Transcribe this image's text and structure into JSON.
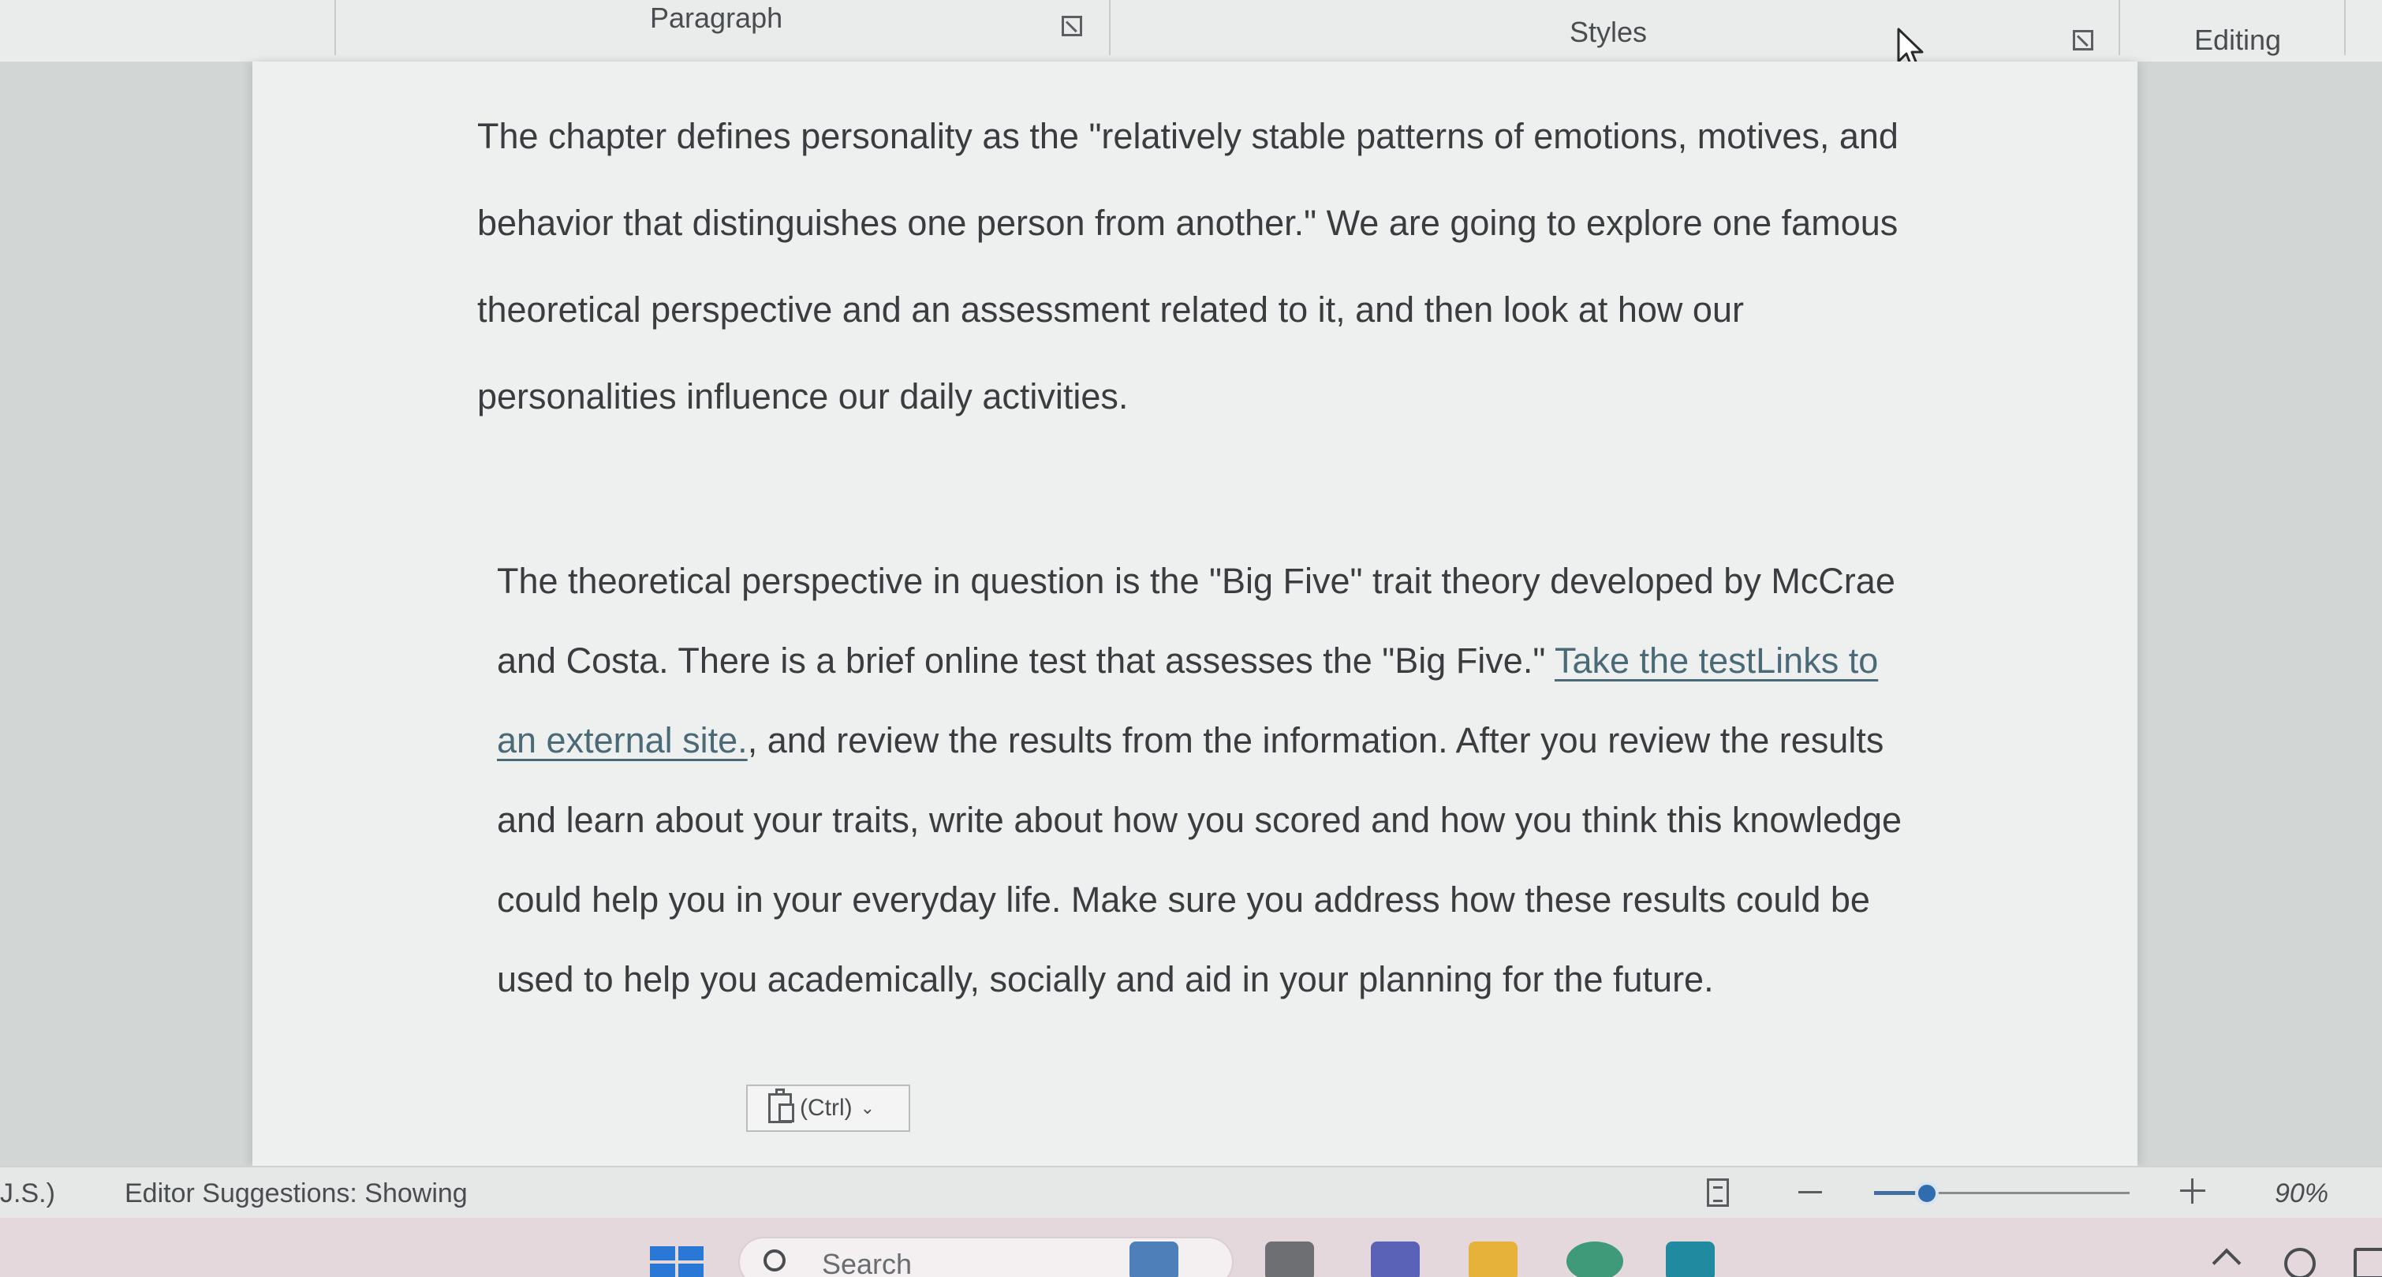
{
  "ribbon": {
    "groups": [
      {
        "label": "Paragraph"
      },
      {
        "label": "Styles"
      },
      {
        "label": "Editing"
      }
    ]
  },
  "document": {
    "paragraph1": "The chapter defines personality as the \"relatively stable patterns of emotions, motives, and behavior that distinguishes one person from another.\" We are going to explore one famous theoretical perspective and an assessment related to it, and then look at how our personalities influence our daily activities.",
    "paragraph2": {
      "before_link": "The theoretical perspective in question is the \"Big Five\" trait theory developed by McCrae and Costa. There is a brief online test that assesses the \"Big Five.\" ",
      "link_text": "Take the testLinks to an external site.",
      "after_link": ", and review the results from the information. After you review the results and learn about your traits, write about how you scored and how you think this knowledge could help you in your everyday life. Make sure you address how these results could be used to help you academically, socially and aid in your planning for the future."
    },
    "paste_options_label": "(Ctrl)"
  },
  "statusbar": {
    "language": "J.S.)",
    "editor_suggestions": "Editor Suggestions: Showing",
    "zoom_level": "90%",
    "zoom_fraction": 0.2
  },
  "taskbar": {
    "search_placeholder": "Search",
    "colors": {
      "windows_blue": "#2a78d6",
      "accent": "#2f6db0"
    }
  }
}
